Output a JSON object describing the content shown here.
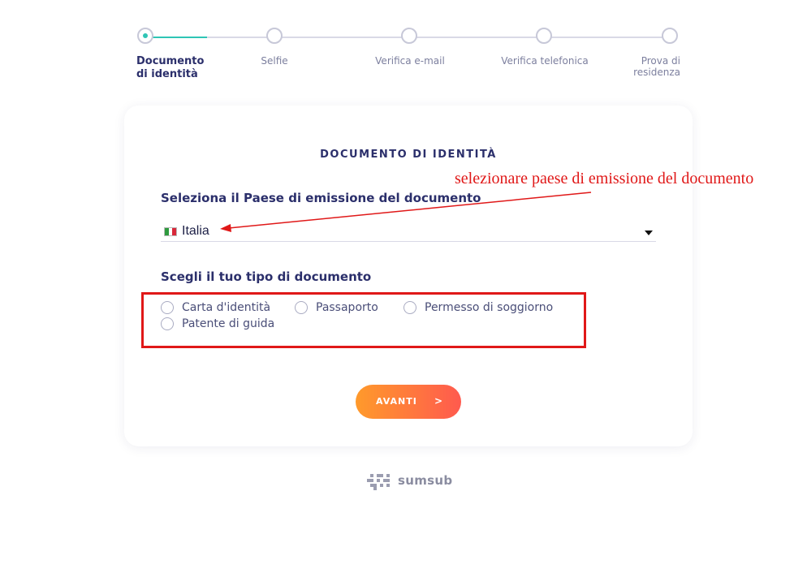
{
  "stepper": {
    "steps": [
      {
        "label_line1": "Documento",
        "label_line2": "di identità"
      },
      {
        "label": "Selfie"
      },
      {
        "label": "Verifica e-mail"
      },
      {
        "label": "Verifica telefonica"
      },
      {
        "label_line1": "Prova di",
        "label_line2": "residenza"
      }
    ],
    "active_color": "#2fc5b5"
  },
  "card": {
    "title": "DOCUMENTO DI IDENTITÀ",
    "country_label": "Seleziona il Paese di emissione del documento",
    "country_value": "Italia",
    "flag_icon": "italy-flag-icon",
    "doc_type_label": "Scegli il tuo tipo di documento",
    "doc_types": [
      "Carta d'identità",
      "Passaporto",
      "Permesso di soggiorno",
      "Patente di guida"
    ],
    "next_button": {
      "label": "AVANTI",
      "arrow": ">"
    }
  },
  "annotation": {
    "text": "selezionare paese di emissione del documento",
    "color": "#e01818"
  },
  "footer": {
    "brand": "sumsub"
  },
  "colors": {
    "primary_text": "#2b2f6b",
    "button_gradient_start": "#ff9a2b",
    "button_gradient_end": "#ff5a4e"
  }
}
